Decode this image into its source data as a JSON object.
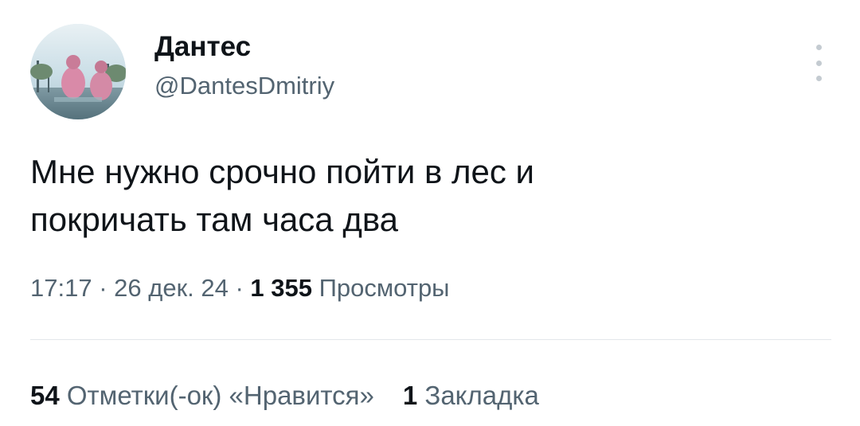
{
  "author": {
    "display_name": "Дантес",
    "handle": "@DantesDmitriy"
  },
  "more_icon": "more-vertical-icon",
  "tweet": {
    "line1": "Мне нужно срочно пойти в лес и",
    "line2": "покричать там часа два"
  },
  "meta": {
    "time": "17:17",
    "sep1": " · ",
    "date": "26 дек. 24",
    "sep2": " · ",
    "views_count": "1 355",
    "views_label": "Просмотры"
  },
  "stats": {
    "likes_count": "54",
    "likes_label": "Отметки(-ок) «Нравится»",
    "bookmarks_count": "1",
    "bookmarks_label": "Закладка"
  }
}
